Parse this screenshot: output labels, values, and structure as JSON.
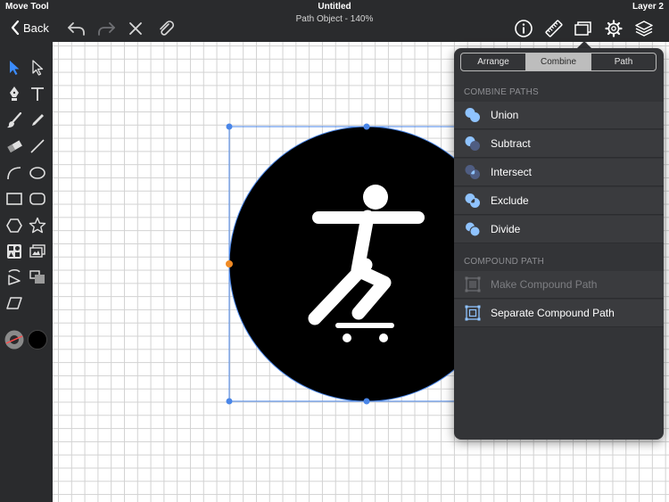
{
  "header": {
    "tool_name": "Move Tool",
    "layer_name": "Layer 2",
    "doc_title": "Untitled",
    "doc_subtitle": "Path Object - 140%",
    "back_label": "Back"
  },
  "toolbar_icons": [
    "undo-icon",
    "redo-icon",
    "close-icon",
    "paperclip-icon",
    "info-icon",
    "ruler-icon",
    "arrange-icon",
    "gear-icon",
    "layers-icon"
  ],
  "tools": [
    "select-arrow-icon",
    "direct-select-icon",
    "pen-icon",
    "text-icon",
    "brush-icon",
    "pencil-icon",
    "eraser-icon",
    "line-icon",
    "arc-icon",
    "ellipse-icon",
    "rectangle-icon",
    "rounded-rectangle-icon",
    "hexagon-icon",
    "star-icon",
    "grid-shapes-icon",
    "image-icon",
    "transform-icon",
    "crop-icon",
    "skew-icon",
    "stroke-color-icon",
    "fill-color-icon"
  ],
  "colors": {
    "accent_blue": "#4a86e8",
    "handle_orange": "#f08a24",
    "fill_color": "#000000"
  },
  "popover": {
    "tabs": [
      {
        "label": "Arrange",
        "active": false
      },
      {
        "label": "Combine",
        "active": true
      },
      {
        "label": "Path",
        "active": false
      }
    ],
    "combine_header": "COMBINE PATHS",
    "combine_items": [
      {
        "label": "Union",
        "icon": "union-icon"
      },
      {
        "label": "Subtract",
        "icon": "subtract-icon"
      },
      {
        "label": "Intersect",
        "icon": "intersect-icon"
      },
      {
        "label": "Exclude",
        "icon": "exclude-icon"
      },
      {
        "label": "Divide",
        "icon": "divide-icon"
      }
    ],
    "compound_header": "COMPOUND PATH",
    "compound_items": [
      {
        "label": "Make Compound Path",
        "icon": "make-compound-path-icon",
        "disabled": true
      },
      {
        "label": "Separate Compound Path",
        "icon": "separate-compound-path-icon",
        "disabled": false
      }
    ]
  }
}
